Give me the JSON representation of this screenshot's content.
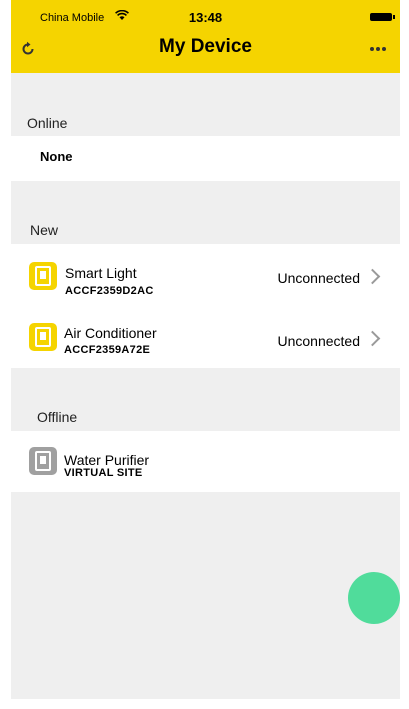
{
  "status_bar": {
    "carrier": "China Mobile",
    "time": "13:48"
  },
  "header": {
    "title": "My Device"
  },
  "sections": {
    "online": {
      "label": "Online",
      "empty_text": "None"
    },
    "new": {
      "label": "New",
      "devices": [
        {
          "name": "Smart Light",
          "id": "ACCF2359D2AC",
          "status": "Unconnected"
        },
        {
          "name": "Air Conditioner",
          "id": "ACCF2359A72E",
          "status": "Unconnected"
        }
      ]
    },
    "offline": {
      "label": "Offline",
      "devices": [
        {
          "name": "Water Purifier",
          "id": "VIRTUAL SITE"
        }
      ]
    }
  },
  "colors": {
    "brand_yellow": "#f5d400",
    "fab_green": "#50dc9b",
    "background": "#efefef"
  }
}
